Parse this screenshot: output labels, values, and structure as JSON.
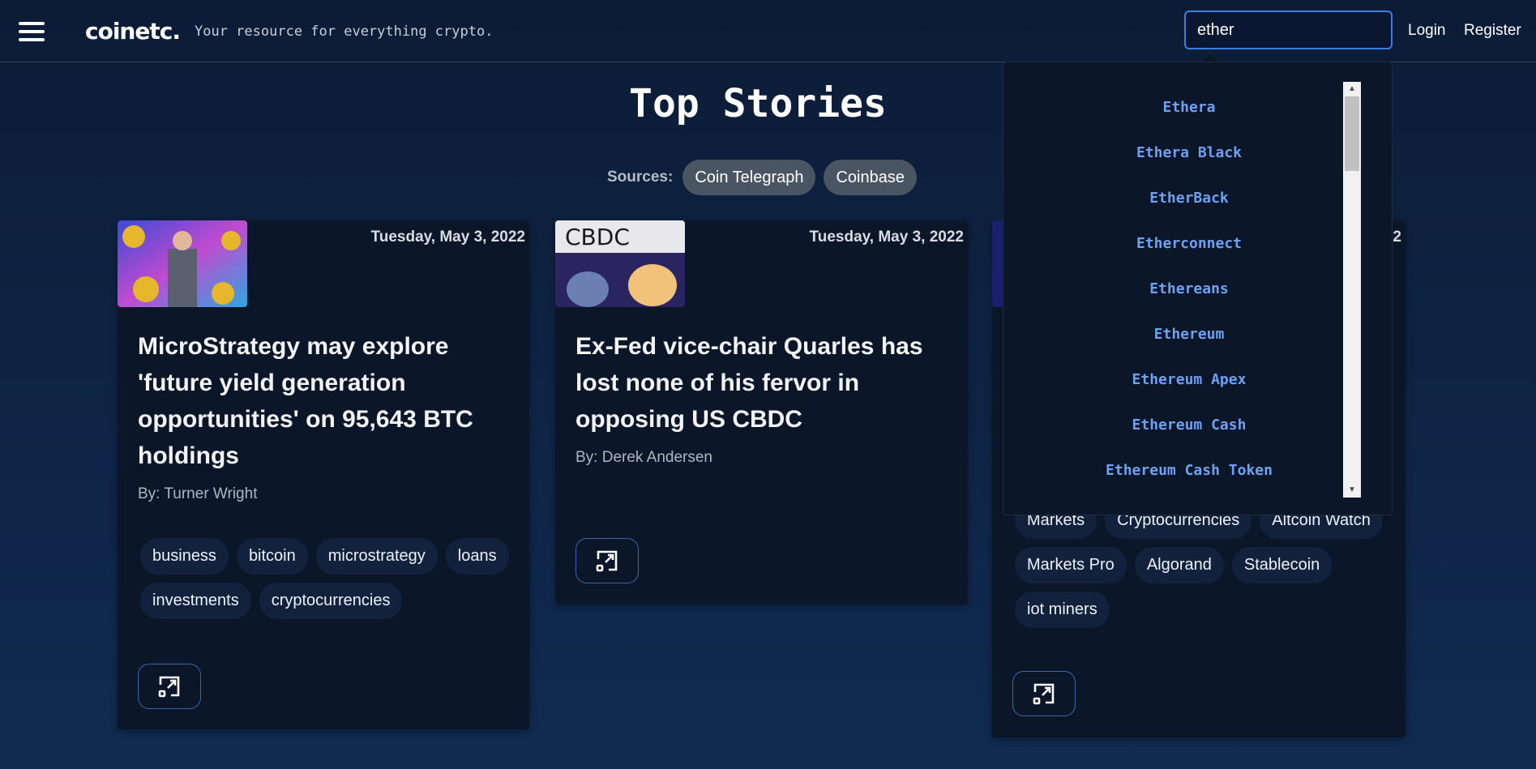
{
  "header": {
    "brand": "coinetc.",
    "tagline": "Your resource for everything crypto.",
    "search_value": "ether",
    "login": "Login",
    "register": "Register"
  },
  "main": {
    "title": "Top Stories",
    "sources_label": "Sources:",
    "sources": [
      "Coin Telegraph",
      "Coinbase"
    ]
  },
  "cards": [
    {
      "date": "Tuesday, May 3, 2022",
      "title": "MicroStrategy may explore 'future yield generation opportunities' on 95,643 BTC holdings",
      "author": "By: Turner Wright",
      "tags": [
        "business",
        "bitcoin",
        "microstrategy",
        "loans",
        "investments",
        "cryptocurrencies"
      ]
    },
    {
      "date": "Tuesday, May 3, 2022",
      "title": "Ex-Fed vice-chair Quarles has lost none of his fervor in opposing US CBDC",
      "author": "By: Derek Andersen",
      "tags": [],
      "thumb_text": "CBDC"
    },
    {
      "date_partial": "2",
      "tags": [
        "Markets",
        "Cryptocurrencies",
        "Altcoin Watch",
        "Markets Pro",
        "Algorand",
        "Stablecoin",
        "iot miners"
      ]
    }
  ],
  "dropdown": {
    "suggestions": [
      "Ethera",
      "Ethera Black",
      "EtherBack",
      "Etherconnect",
      "Ethereans",
      "Ethereum",
      "Ethereum Apex",
      "Ethereum Cash",
      "Ethereum Cash Token"
    ]
  },
  "colors": {
    "background": "#0f2547",
    "card": "#0b1628",
    "accent": "#3d7fe0",
    "suggestion_text": "#6ea1f2",
    "chip_source": "#4a5563",
    "tag": "#12223d"
  },
  "icons": {
    "menu": "hamburger-icon",
    "open": "open-external-icon"
  }
}
